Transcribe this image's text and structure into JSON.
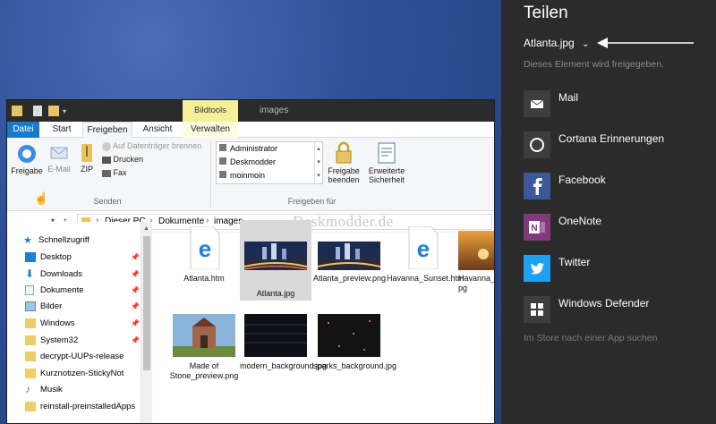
{
  "explorer": {
    "title_context_tab": "Bildtools",
    "title": "images",
    "tabs": [
      "Datei",
      "Start",
      "Freigeben",
      "Ansicht",
      "Verwalten"
    ],
    "ribbon": {
      "share_label": "Freigabe",
      "email_label": "E-Mail",
      "zip_label": "ZIP",
      "burn_label": "Auf Datenträger brennen",
      "print_label": "Drucken",
      "fax_label": "Fax",
      "group_send": "Senden",
      "users": [
        "Administrator",
        "Deskmodder",
        "moinmoin"
      ],
      "stop_sharing_label": "Freigabe beenden",
      "advanced_security_label": "Erweiterte Sicherheit",
      "group_share_with": "Freigeben für"
    },
    "breadcrumb": [
      "Dieser PC",
      "Dokumente",
      "images"
    ],
    "watermark": "Deskmodder.de",
    "nav": [
      {
        "label": "Schnellzugriff",
        "icon": "star-icon",
        "pinned": false
      },
      {
        "label": "Desktop",
        "icon": "desktop-folder-icon",
        "pinned": true
      },
      {
        "label": "Downloads",
        "icon": "download-icon",
        "pinned": true
      },
      {
        "label": "Dokumente",
        "icon": "documents-icon",
        "pinned": true
      },
      {
        "label": "Bilder",
        "icon": "pictures-icon",
        "pinned": true
      },
      {
        "label": "Windows",
        "icon": "folder-icon",
        "pinned": true
      },
      {
        "label": "System32",
        "icon": "folder-icon",
        "pinned": true
      },
      {
        "label": "decrypt-UUPs-release",
        "icon": "folder-icon",
        "pinned": false
      },
      {
        "label": "Kurznotizen-StickyNot",
        "icon": "folder-icon",
        "pinned": false
      },
      {
        "label": "Musik",
        "icon": "music-icon",
        "pinned": false
      },
      {
        "label": "reinstall-preinstalledApps",
        "icon": "folder-icon",
        "pinned": false
      }
    ],
    "pin_glyph": "📌",
    "files": [
      {
        "name": "Atlanta.htm",
        "kind": "edge"
      },
      {
        "name": "Atlanta.jpg",
        "kind": "city",
        "selected": true
      },
      {
        "name": "Atlanta_preview.png",
        "kind": "city"
      },
      {
        "name": "Havanna_Sunset.htm",
        "kind": "edge"
      },
      {
        "name": "Havanna_S pg",
        "kind": "sunset"
      },
      {
        "name": "Made of Stone_preview.png",
        "kind": "church"
      },
      {
        "name": "modern_background.jpg",
        "kind": "dark"
      },
      {
        "name": "sparks_background.jpg",
        "kind": "sparks"
      }
    ]
  },
  "share": {
    "title": "Teilen",
    "item": "Atlanta.jpg",
    "subtitle": "Dieses Element wird freigegeben.",
    "apps": [
      {
        "label": "Mail",
        "icon": "mail-icon",
        "color": "#3d3d3d"
      },
      {
        "label": "Cortana Erinnerungen",
        "icon": "cortana-icon",
        "color": "#3d3d3d"
      },
      {
        "label": "Facebook",
        "icon": "facebook-icon",
        "color": "#3b5998"
      },
      {
        "label": "OneNote",
        "icon": "onenote-icon",
        "color": "#80397b"
      },
      {
        "label": "Twitter",
        "icon": "twitter-icon",
        "color": "#1da1f2"
      },
      {
        "label": "Windows Defender",
        "icon": "windows-icon",
        "color": "#3d3d3d"
      }
    ],
    "store_link": "Im Store nach einer App suchen"
  }
}
